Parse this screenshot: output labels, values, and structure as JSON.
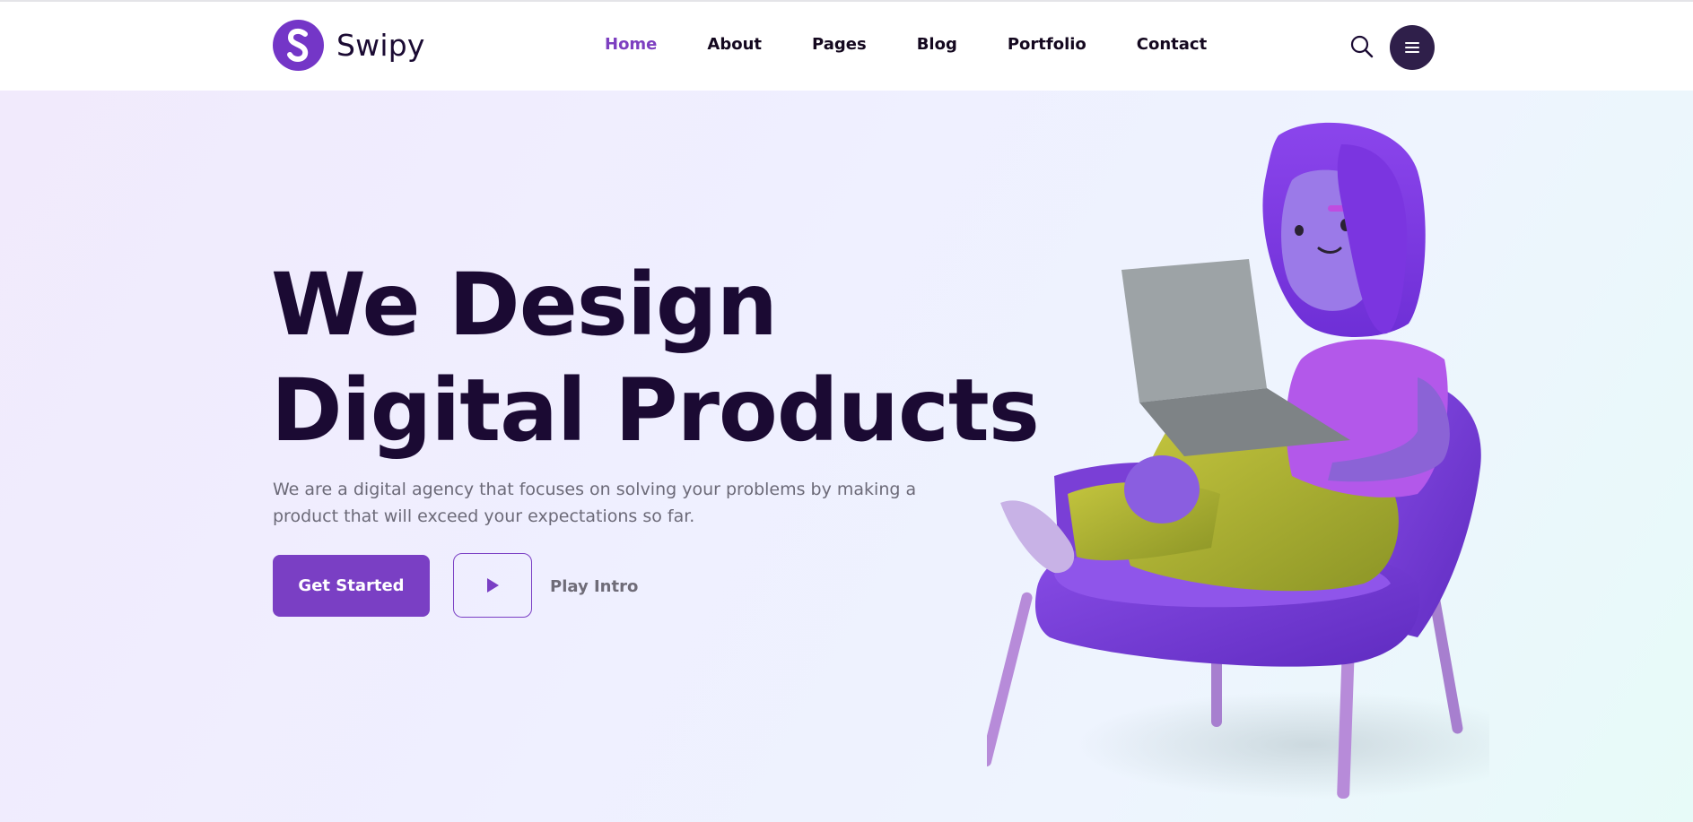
{
  "brand": {
    "name": "Swipy",
    "logo_icon": "swipy-s-logo-icon",
    "accent_color": "#7436c7"
  },
  "nav": {
    "items": [
      {
        "label": "Home",
        "active": true
      },
      {
        "label": "About",
        "active": false
      },
      {
        "label": "Pages",
        "active": false
      },
      {
        "label": "Blog",
        "active": false
      },
      {
        "label": "Portfolio",
        "active": false
      },
      {
        "label": "Contact",
        "active": false
      }
    ],
    "search_icon": "search-icon",
    "menu_icon": "hamburger-menu-icon"
  },
  "hero": {
    "title_line1": "We Design",
    "title_line2": "Digital Products",
    "description": "We are a digital agency that focuses on solving your problems by making a product that will exceed your expectations so far.",
    "cta_label": "Get Started",
    "play_icon": "play-icon",
    "play_label": "Play Intro",
    "illustration": "3d-girl-with-laptop-on-purple-chair"
  },
  "colors": {
    "title": "#1b0a33",
    "primary_button": "#7a3fc4",
    "menu_button": "#2f1f4a",
    "active_nav": "#7d3fc0"
  }
}
